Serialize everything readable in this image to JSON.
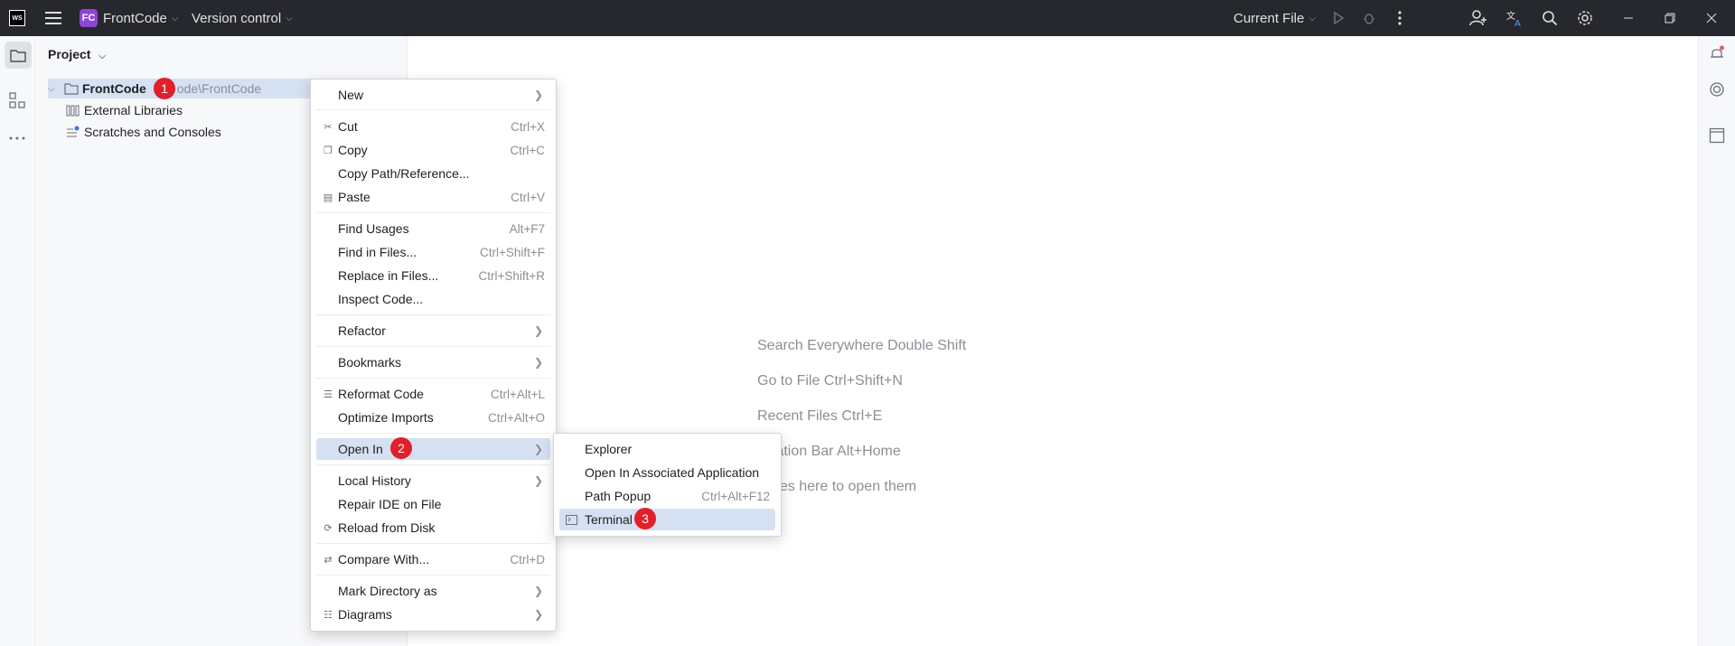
{
  "titlebar": {
    "logo": "WS",
    "project_badge": "FC",
    "project_name": "FrontCode",
    "vcs": "Version control",
    "run_config": "Current File"
  },
  "project_panel": {
    "title": "Project",
    "tree": [
      {
        "label": "FrontCode",
        "path": "ode\\FrontCode"
      },
      {
        "label": "External Libraries"
      },
      {
        "label": "Scratches and Consoles"
      }
    ]
  },
  "editor_hints": [
    "Search Everywhere Double Shift",
    "Go to File Ctrl+Shift+N",
    "Recent Files Ctrl+E",
    "vigation Bar Alt+Home",
    "p files here to open them"
  ],
  "context_menu": {
    "items": [
      {
        "label": "New",
        "shortcut": "",
        "submenu": true
      },
      {
        "label": "Cut",
        "shortcut": "Ctrl+X",
        "icon": "scissors-icon"
      },
      {
        "label": "Copy",
        "shortcut": "Ctrl+C",
        "icon": "copy-icon"
      },
      {
        "label": "Copy Path/Reference...",
        "shortcut": ""
      },
      {
        "label": "Paste",
        "shortcut": "Ctrl+V",
        "icon": "paste-icon"
      },
      {
        "label": "Find Usages",
        "shortcut": "Alt+F7"
      },
      {
        "label": "Find in Files...",
        "shortcut": "Ctrl+Shift+F"
      },
      {
        "label": "Replace in Files...",
        "shortcut": "Ctrl+Shift+R"
      },
      {
        "label": "Inspect Code...",
        "shortcut": ""
      },
      {
        "label": "Refactor",
        "submenu": true
      },
      {
        "label": "Bookmarks",
        "submenu": true
      },
      {
        "label": "Reformat Code",
        "shortcut": "Ctrl+Alt+L",
        "icon": "reformat-icon"
      },
      {
        "label": "Optimize Imports",
        "shortcut": "Ctrl+Alt+O"
      },
      {
        "label": "Open In",
        "submenu": true
      },
      {
        "label": "Local History",
        "submenu": true
      },
      {
        "label": "Repair IDE on File",
        "shortcut": ""
      },
      {
        "label": "Reload from Disk",
        "shortcut": "",
        "icon": "reload-icon"
      },
      {
        "label": "Compare With...",
        "shortcut": "Ctrl+D",
        "icon": "compare-icon"
      },
      {
        "label": "Mark Directory as",
        "submenu": true
      },
      {
        "label": "Diagrams",
        "submenu": true,
        "icon": "diagram-icon"
      }
    ]
  },
  "open_in_submenu": {
    "items": [
      {
        "label": "Explorer",
        "shortcut": ""
      },
      {
        "label": "Open In Associated Application",
        "shortcut": ""
      },
      {
        "label": "Path Popup",
        "shortcut": "Ctrl+Alt+F12"
      },
      {
        "label": "Terminal",
        "shortcut": "",
        "icon": "terminal-icon"
      }
    ]
  },
  "step_badges": [
    "1",
    "2",
    "3"
  ]
}
